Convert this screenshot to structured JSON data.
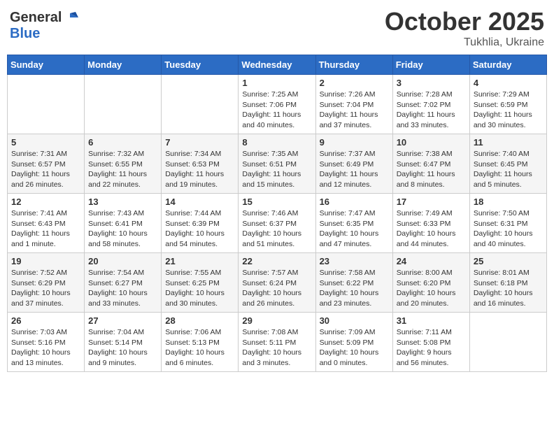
{
  "header": {
    "logo_line1": "General",
    "logo_line2": "Blue",
    "month_title": "October 2025",
    "location": "Tukhlia, Ukraine"
  },
  "weekdays": [
    "Sunday",
    "Monday",
    "Tuesday",
    "Wednesday",
    "Thursday",
    "Friday",
    "Saturday"
  ],
  "weeks": [
    [
      {
        "day": "",
        "sunrise": "",
        "sunset": "",
        "daylight": ""
      },
      {
        "day": "",
        "sunrise": "",
        "sunset": "",
        "daylight": ""
      },
      {
        "day": "",
        "sunrise": "",
        "sunset": "",
        "daylight": ""
      },
      {
        "day": "1",
        "sunrise": "Sunrise: 7:25 AM",
        "sunset": "Sunset: 7:06 PM",
        "daylight": "Daylight: 11 hours and 40 minutes."
      },
      {
        "day": "2",
        "sunrise": "Sunrise: 7:26 AM",
        "sunset": "Sunset: 7:04 PM",
        "daylight": "Daylight: 11 hours and 37 minutes."
      },
      {
        "day": "3",
        "sunrise": "Sunrise: 7:28 AM",
        "sunset": "Sunset: 7:02 PM",
        "daylight": "Daylight: 11 hours and 33 minutes."
      },
      {
        "day": "4",
        "sunrise": "Sunrise: 7:29 AM",
        "sunset": "Sunset: 6:59 PM",
        "daylight": "Daylight: 11 hours and 30 minutes."
      }
    ],
    [
      {
        "day": "5",
        "sunrise": "Sunrise: 7:31 AM",
        "sunset": "Sunset: 6:57 PM",
        "daylight": "Daylight: 11 hours and 26 minutes."
      },
      {
        "day": "6",
        "sunrise": "Sunrise: 7:32 AM",
        "sunset": "Sunset: 6:55 PM",
        "daylight": "Daylight: 11 hours and 22 minutes."
      },
      {
        "day": "7",
        "sunrise": "Sunrise: 7:34 AM",
        "sunset": "Sunset: 6:53 PM",
        "daylight": "Daylight: 11 hours and 19 minutes."
      },
      {
        "day": "8",
        "sunrise": "Sunrise: 7:35 AM",
        "sunset": "Sunset: 6:51 PM",
        "daylight": "Daylight: 11 hours and 15 minutes."
      },
      {
        "day": "9",
        "sunrise": "Sunrise: 7:37 AM",
        "sunset": "Sunset: 6:49 PM",
        "daylight": "Daylight: 11 hours and 12 minutes."
      },
      {
        "day": "10",
        "sunrise": "Sunrise: 7:38 AM",
        "sunset": "Sunset: 6:47 PM",
        "daylight": "Daylight: 11 hours and 8 minutes."
      },
      {
        "day": "11",
        "sunrise": "Sunrise: 7:40 AM",
        "sunset": "Sunset: 6:45 PM",
        "daylight": "Daylight: 11 hours and 5 minutes."
      }
    ],
    [
      {
        "day": "12",
        "sunrise": "Sunrise: 7:41 AM",
        "sunset": "Sunset: 6:43 PM",
        "daylight": "Daylight: 11 hours and 1 minute."
      },
      {
        "day": "13",
        "sunrise": "Sunrise: 7:43 AM",
        "sunset": "Sunset: 6:41 PM",
        "daylight": "Daylight: 10 hours and 58 minutes."
      },
      {
        "day": "14",
        "sunrise": "Sunrise: 7:44 AM",
        "sunset": "Sunset: 6:39 PM",
        "daylight": "Daylight: 10 hours and 54 minutes."
      },
      {
        "day": "15",
        "sunrise": "Sunrise: 7:46 AM",
        "sunset": "Sunset: 6:37 PM",
        "daylight": "Daylight: 10 hours and 51 minutes."
      },
      {
        "day": "16",
        "sunrise": "Sunrise: 7:47 AM",
        "sunset": "Sunset: 6:35 PM",
        "daylight": "Daylight: 10 hours and 47 minutes."
      },
      {
        "day": "17",
        "sunrise": "Sunrise: 7:49 AM",
        "sunset": "Sunset: 6:33 PM",
        "daylight": "Daylight: 10 hours and 44 minutes."
      },
      {
        "day": "18",
        "sunrise": "Sunrise: 7:50 AM",
        "sunset": "Sunset: 6:31 PM",
        "daylight": "Daylight: 10 hours and 40 minutes."
      }
    ],
    [
      {
        "day": "19",
        "sunrise": "Sunrise: 7:52 AM",
        "sunset": "Sunset: 6:29 PM",
        "daylight": "Daylight: 10 hours and 37 minutes."
      },
      {
        "day": "20",
        "sunrise": "Sunrise: 7:54 AM",
        "sunset": "Sunset: 6:27 PM",
        "daylight": "Daylight: 10 hours and 33 minutes."
      },
      {
        "day": "21",
        "sunrise": "Sunrise: 7:55 AM",
        "sunset": "Sunset: 6:25 PM",
        "daylight": "Daylight: 10 hours and 30 minutes."
      },
      {
        "day": "22",
        "sunrise": "Sunrise: 7:57 AM",
        "sunset": "Sunset: 6:24 PM",
        "daylight": "Daylight: 10 hours and 26 minutes."
      },
      {
        "day": "23",
        "sunrise": "Sunrise: 7:58 AM",
        "sunset": "Sunset: 6:22 PM",
        "daylight": "Daylight: 10 hours and 23 minutes."
      },
      {
        "day": "24",
        "sunrise": "Sunrise: 8:00 AM",
        "sunset": "Sunset: 6:20 PM",
        "daylight": "Daylight: 10 hours and 20 minutes."
      },
      {
        "day": "25",
        "sunrise": "Sunrise: 8:01 AM",
        "sunset": "Sunset: 6:18 PM",
        "daylight": "Daylight: 10 hours and 16 minutes."
      }
    ],
    [
      {
        "day": "26",
        "sunrise": "Sunrise: 7:03 AM",
        "sunset": "Sunset: 5:16 PM",
        "daylight": "Daylight: 10 hours and 13 minutes."
      },
      {
        "day": "27",
        "sunrise": "Sunrise: 7:04 AM",
        "sunset": "Sunset: 5:14 PM",
        "daylight": "Daylight: 10 hours and 9 minutes."
      },
      {
        "day": "28",
        "sunrise": "Sunrise: 7:06 AM",
        "sunset": "Sunset: 5:13 PM",
        "daylight": "Daylight: 10 hours and 6 minutes."
      },
      {
        "day": "29",
        "sunrise": "Sunrise: 7:08 AM",
        "sunset": "Sunset: 5:11 PM",
        "daylight": "Daylight: 10 hours and 3 minutes."
      },
      {
        "day": "30",
        "sunrise": "Sunrise: 7:09 AM",
        "sunset": "Sunset: 5:09 PM",
        "daylight": "Daylight: 10 hours and 0 minutes."
      },
      {
        "day": "31",
        "sunrise": "Sunrise: 7:11 AM",
        "sunset": "Sunset: 5:08 PM",
        "daylight": "Daylight: 9 hours and 56 minutes."
      },
      {
        "day": "",
        "sunrise": "",
        "sunset": "",
        "daylight": ""
      }
    ]
  ]
}
